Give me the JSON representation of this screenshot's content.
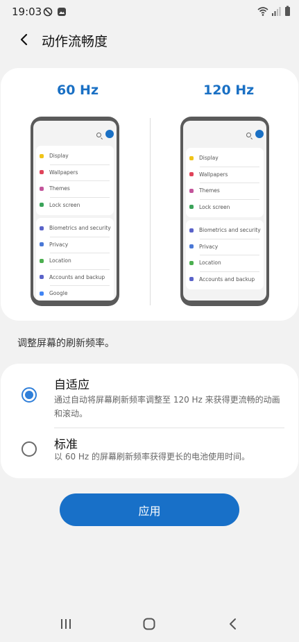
{
  "status_bar": {
    "time": "19:03",
    "left_icons": [
      "blocked-icon",
      "image-notification-icon"
    ],
    "right_icons": [
      "wifi-icon",
      "signal-icon",
      "battery-icon"
    ]
  },
  "header": {
    "title": "动作流畅度",
    "back_icon": "chevron-left-icon"
  },
  "preview": {
    "left_label": "60 Hz",
    "right_label": "120 Hz",
    "phone_group1": [
      {
        "label": "Display",
        "color": "#f0c419"
      },
      {
        "label": "Wallpapers",
        "color": "#e0445a"
      },
      {
        "label": "Themes",
        "color": "#c3559b"
      },
      {
        "label": "Lock screen",
        "color": "#3ba35a"
      }
    ],
    "phone_group2": [
      {
        "label": "Biometrics and security",
        "color": "#5a63c9"
      },
      {
        "label": "Privacy",
        "color": "#4a78d6"
      },
      {
        "label": "Location",
        "color": "#4caf50"
      },
      {
        "label": "Accounts and backup",
        "color": "#5a63c9"
      },
      {
        "label": "Google",
        "color": "#4285f4"
      }
    ]
  },
  "description": "调整屏幕的刷新频率。",
  "options": {
    "adaptive": {
      "title": "自适应",
      "description": "通过自动将屏幕刷新频率调整至 120 Hz 来获得更流畅的动画和滚动。",
      "selected": true
    },
    "standard": {
      "title": "标准",
      "description": "以 60 Hz 的屏幕刷新频率获得更长的电池使用时间。",
      "selected": false
    }
  },
  "apply_button": "应用",
  "nav_bar": {
    "icons": [
      "recent-apps-icon",
      "home-icon",
      "back-icon"
    ]
  },
  "colors": {
    "accent": "#1870c8",
    "hz_label": "#1a70c4",
    "radio_selected": "#2f7fd9",
    "background": "#f2f2f2"
  }
}
